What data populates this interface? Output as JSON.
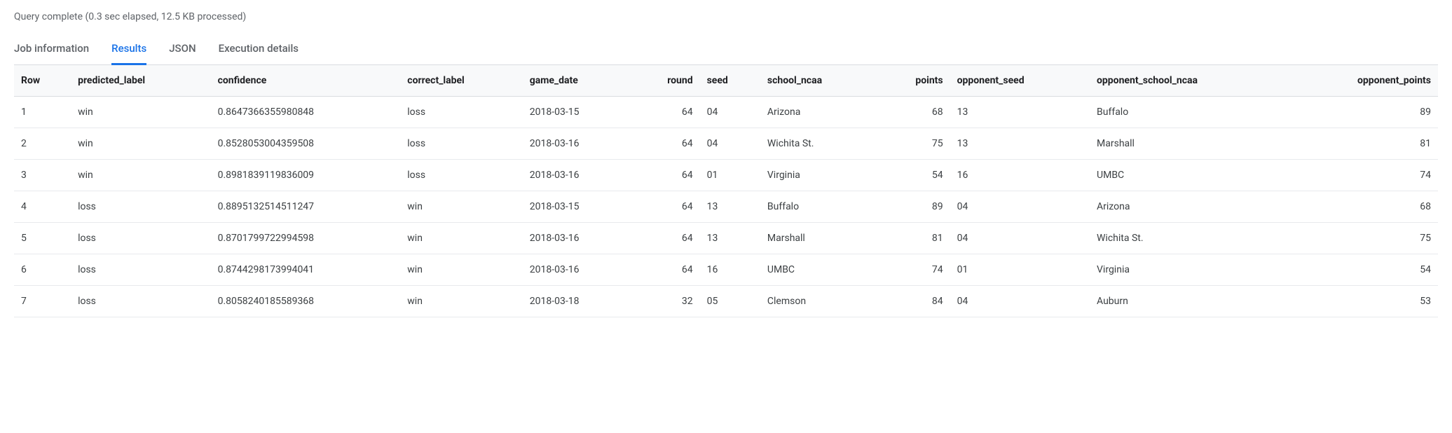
{
  "status": "Query complete (0.3 sec elapsed, 12.5 KB processed)",
  "tabs": [
    {
      "label": "Job information",
      "active": false
    },
    {
      "label": "Results",
      "active": true
    },
    {
      "label": "JSON",
      "active": false
    },
    {
      "label": "Execution details",
      "active": false
    }
  ],
  "table": {
    "columns": [
      {
        "key": "row",
        "label": "Row",
        "align": "left"
      },
      {
        "key": "predicted_label",
        "label": "predicted_label",
        "align": "left"
      },
      {
        "key": "confidence",
        "label": "confidence",
        "align": "left"
      },
      {
        "key": "correct_label",
        "label": "correct_label",
        "align": "left"
      },
      {
        "key": "game_date",
        "label": "game_date",
        "align": "left"
      },
      {
        "key": "round",
        "label": "round",
        "align": "right"
      },
      {
        "key": "seed",
        "label": "seed",
        "align": "left"
      },
      {
        "key": "school_ncaa",
        "label": "school_ncaa",
        "align": "left"
      },
      {
        "key": "points",
        "label": "points",
        "align": "right"
      },
      {
        "key": "opponent_seed",
        "label": "opponent_seed",
        "align": "left"
      },
      {
        "key": "opponent_school_ncaa",
        "label": "opponent_school_ncaa",
        "align": "left"
      },
      {
        "key": "opponent_points",
        "label": "opponent_points",
        "align": "right"
      }
    ],
    "rows": [
      {
        "row": "1",
        "predicted_label": "win",
        "confidence": "0.8647366355980848",
        "correct_label": "loss",
        "game_date": "2018-03-15",
        "round": "64",
        "seed": "04",
        "school_ncaa": "Arizona",
        "points": "68",
        "opponent_seed": "13",
        "opponent_school_ncaa": "Buffalo",
        "opponent_points": "89"
      },
      {
        "row": "2",
        "predicted_label": "win",
        "confidence": "0.8528053004359508",
        "correct_label": "loss",
        "game_date": "2018-03-16",
        "round": "64",
        "seed": "04",
        "school_ncaa": "Wichita St.",
        "points": "75",
        "opponent_seed": "13",
        "opponent_school_ncaa": "Marshall",
        "opponent_points": "81"
      },
      {
        "row": "3",
        "predicted_label": "win",
        "confidence": "0.8981839119836009",
        "correct_label": "loss",
        "game_date": "2018-03-16",
        "round": "64",
        "seed": "01",
        "school_ncaa": "Virginia",
        "points": "54",
        "opponent_seed": "16",
        "opponent_school_ncaa": "UMBC",
        "opponent_points": "74"
      },
      {
        "row": "4",
        "predicted_label": "loss",
        "confidence": "0.8895132514511247",
        "correct_label": "win",
        "game_date": "2018-03-15",
        "round": "64",
        "seed": "13",
        "school_ncaa": "Buffalo",
        "points": "89",
        "opponent_seed": "04",
        "opponent_school_ncaa": "Arizona",
        "opponent_points": "68"
      },
      {
        "row": "5",
        "predicted_label": "loss",
        "confidence": "0.8701799722994598",
        "correct_label": "win",
        "game_date": "2018-03-16",
        "round": "64",
        "seed": "13",
        "school_ncaa": "Marshall",
        "points": "81",
        "opponent_seed": "04",
        "opponent_school_ncaa": "Wichita St.",
        "opponent_points": "75"
      },
      {
        "row": "6",
        "predicted_label": "loss",
        "confidence": "0.8744298173994041",
        "correct_label": "win",
        "game_date": "2018-03-16",
        "round": "64",
        "seed": "16",
        "school_ncaa": "UMBC",
        "points": "74",
        "opponent_seed": "01",
        "opponent_school_ncaa": "Virginia",
        "opponent_points": "54"
      },
      {
        "row": "7",
        "predicted_label": "loss",
        "confidence": "0.8058240185589368",
        "correct_label": "win",
        "game_date": "2018-03-18",
        "round": "32",
        "seed": "05",
        "school_ncaa": "Clemson",
        "points": "84",
        "opponent_seed": "04",
        "opponent_school_ncaa": "Auburn",
        "opponent_points": "53"
      }
    ]
  }
}
